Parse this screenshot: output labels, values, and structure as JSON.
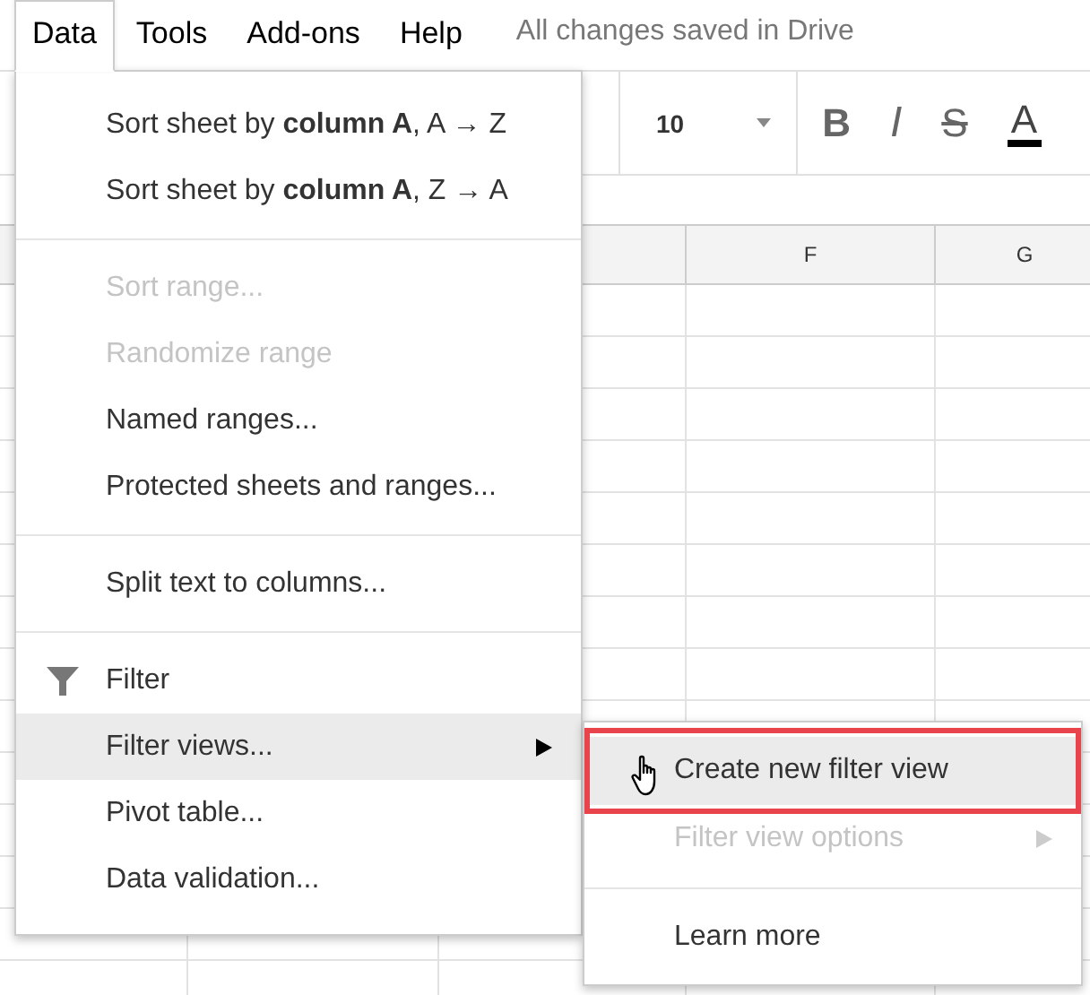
{
  "menubar": {
    "items": [
      {
        "label": "Data",
        "selected": true
      },
      {
        "label": "Tools",
        "selected": false
      },
      {
        "label": "Add-ons",
        "selected": false
      },
      {
        "label": "Help",
        "selected": false
      }
    ],
    "status": "All changes saved in Drive"
  },
  "toolbar": {
    "font_size": "10",
    "format_buttons": [
      "B",
      "I",
      "S",
      "A"
    ]
  },
  "sheet": {
    "column_headers": [
      "F",
      "G"
    ]
  },
  "data_menu": {
    "items": [
      {
        "kind": "item",
        "label": "Sort sheet by **column A**, A → Z",
        "disabled": false,
        "selected": false,
        "has_icon": false,
        "has_submenu": false
      },
      {
        "kind": "item",
        "label": "Sort sheet by **column A**, Z → A",
        "disabled": false,
        "selected": false,
        "has_icon": false,
        "has_submenu": false
      },
      {
        "kind": "separator"
      },
      {
        "kind": "item",
        "label": "Sort range...",
        "disabled": true,
        "selected": false,
        "has_icon": false,
        "has_submenu": false
      },
      {
        "kind": "item",
        "label": "Randomize range",
        "disabled": true,
        "selected": false,
        "has_icon": false,
        "has_submenu": false
      },
      {
        "kind": "item",
        "label": "Named ranges...",
        "disabled": false,
        "selected": false,
        "has_icon": false,
        "has_submenu": false
      },
      {
        "kind": "item",
        "label": "Protected sheets and ranges...",
        "disabled": false,
        "selected": false,
        "has_icon": false,
        "has_submenu": false
      },
      {
        "kind": "separator"
      },
      {
        "kind": "item",
        "label": "Split text to columns...",
        "disabled": false,
        "selected": false,
        "has_icon": false,
        "has_submenu": false
      },
      {
        "kind": "separator"
      },
      {
        "kind": "item",
        "label": "Filter",
        "disabled": false,
        "selected": false,
        "has_icon": true,
        "has_submenu": false
      },
      {
        "kind": "item",
        "label": "Filter views...",
        "disabled": false,
        "selected": true,
        "has_icon": false,
        "has_submenu": true
      },
      {
        "kind": "item",
        "label": "Pivot table...",
        "disabled": false,
        "selected": false,
        "has_icon": false,
        "has_submenu": false
      },
      {
        "kind": "item",
        "label": "Data validation...",
        "disabled": false,
        "selected": false,
        "has_icon": false,
        "has_submenu": false
      }
    ]
  },
  "submenu": {
    "items": [
      {
        "kind": "item",
        "label": "Create new filter view",
        "disabled": false,
        "selected": true,
        "has_submenu": false,
        "outlined": true,
        "cursor": true
      },
      {
        "kind": "item",
        "label": "Filter view options",
        "disabled": true,
        "selected": false,
        "has_submenu": true,
        "outlined": false,
        "cursor": false
      },
      {
        "kind": "separator"
      },
      {
        "kind": "item",
        "label": "Learn more",
        "disabled": false,
        "selected": false,
        "has_submenu": false,
        "outlined": false,
        "cursor": false
      }
    ]
  }
}
